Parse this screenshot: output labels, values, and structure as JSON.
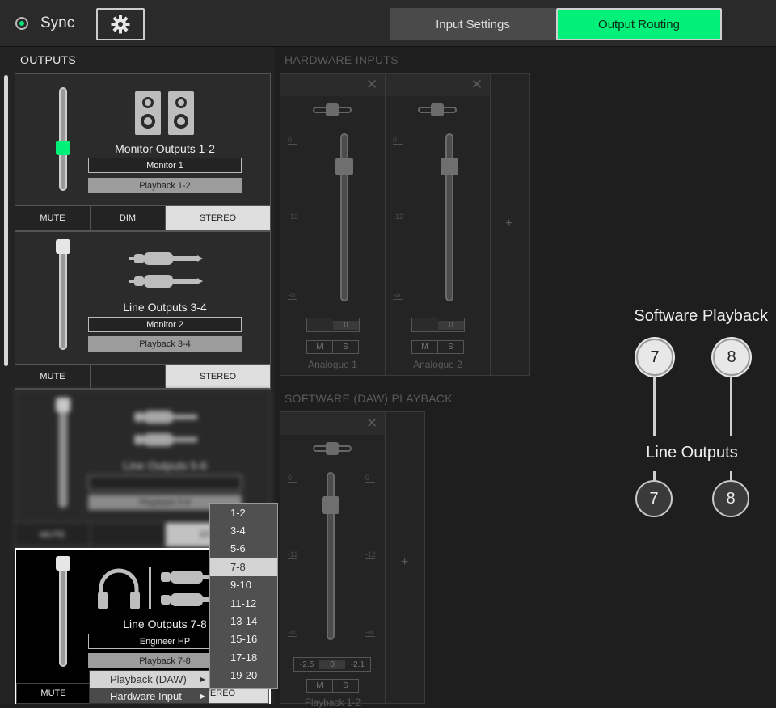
{
  "header": {
    "sync_label": "Sync",
    "tabs": [
      {
        "label": "Input Settings",
        "active": false
      },
      {
        "label": "Output Routing",
        "active": true
      }
    ],
    "accent_color": "#00f07a"
  },
  "outputs": {
    "title": "OUTPUTS",
    "cards": [
      {
        "name": "Monitor Outputs 1-2",
        "label_field": "Monitor 1",
        "source": "Playback 1-2",
        "buttons": [
          "MUTE",
          "DIM",
          "STEREO"
        ]
      },
      {
        "name": "Line Outputs 3-4",
        "label_field": "Monitor 2",
        "source": "Playback 3-4",
        "buttons": [
          "MUTE",
          "STEREO"
        ]
      },
      {
        "name": "Line Outputs 5-6",
        "label_field": "",
        "source": "Playback 5-6",
        "buttons": [
          "MUTE",
          "STEREO"
        ]
      },
      {
        "name": "Line Outputs 7-8",
        "label_field": "Engineer HP",
        "source": "Playback 7-8",
        "buttons": [
          "MUTE",
          "STEREO"
        ]
      }
    ]
  },
  "hardware_inputs": {
    "title": "HARDWARE INPUTS",
    "channels": [
      {
        "name": "Analogue 1",
        "gain": "0",
        "mute": "M",
        "solo": "S"
      },
      {
        "name": "Analogue 2",
        "gain": "0",
        "mute": "M",
        "solo": "S"
      }
    ],
    "scale": [
      "0",
      "-12",
      "-∞"
    ]
  },
  "daw_playback": {
    "title": "SOFTWARE (DAW) PLAYBACK",
    "channel": {
      "name": "Playback 1-2",
      "gain_left": "-2.5",
      "gain_center": "0",
      "gain_right": "-2.1",
      "mute": "M",
      "solo": "S"
    }
  },
  "diagram": {
    "top_label": "Software Playback",
    "bottom_label": "Line Outputs",
    "top_channels": [
      "7",
      "8"
    ],
    "bottom_channels": [
      "7",
      "8"
    ]
  },
  "dropdown": {
    "options": [
      "1-2",
      "3-4",
      "5-6",
      "7-8",
      "9-10",
      "11-12",
      "13-14",
      "15-16",
      "17-18",
      "19-20"
    ],
    "selected": "7-8"
  },
  "context_menu": {
    "items": [
      "Playback (DAW)",
      "Hardware Input"
    ]
  }
}
